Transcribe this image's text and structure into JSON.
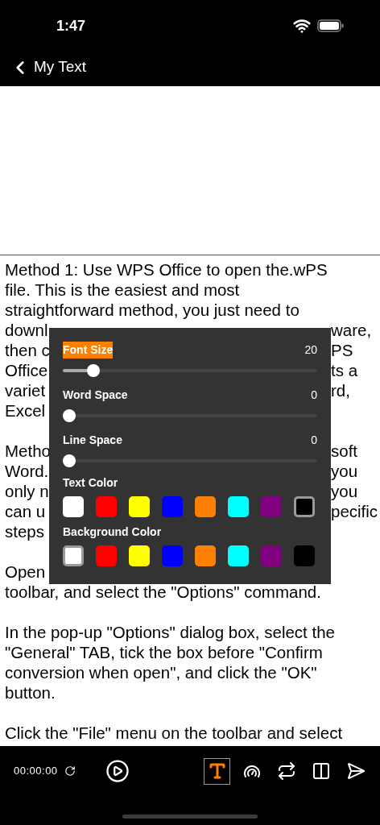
{
  "status_bar": {
    "time": "1:47"
  },
  "nav": {
    "back_label": "My Text"
  },
  "document": {
    "paragraphs": [
      {
        "lines": [
          {
            "left": "Method 1: Use WPS Office to open the.wPS"
          },
          {
            "left": "file. This is the easiest and most"
          },
          {
            "left": "straightforward method, you just need to"
          },
          {
            "left": "downl",
            "right": "ware,"
          },
          {
            "left": "then c",
            "right": "PS"
          },
          {
            "left": "Office",
            "right": "ts a"
          },
          {
            "left": "variet",
            "right": "rd,"
          },
          {
            "left": "Excel"
          }
        ]
      },
      {
        "lines": [
          {
            "left": "Metho",
            "right": "soft"
          },
          {
            "left": "Word.",
            "right": "you"
          },
          {
            "left": "only n",
            "right": "you"
          },
          {
            "left": "can u",
            "right": "pecific"
          },
          {
            "left": "steps"
          }
        ]
      },
      {
        "lines": [
          {
            "left": "Open"
          },
          {
            "left": "toolbar, and select the \"Options\" command."
          }
        ]
      },
      {
        "lines": [
          {
            "left": "In the pop-up \"Options\" dialog box, select the"
          },
          {
            "left": "\"General\" TAB, tick the box before \"Confirm"
          },
          {
            "left": "conversion when open\", and click the \"OK\""
          },
          {
            "left": "button."
          }
        ]
      },
      {
        "lines": [
          {
            "left": "Click the \"File\" menu on the toolbar and select"
          }
        ]
      }
    ]
  },
  "settings_panel": {
    "sliders": [
      {
        "label": "Font Size",
        "value": "20",
        "level": 0.1,
        "highlighted": true
      },
      {
        "label": "Word Space",
        "value": "0",
        "level": 0,
        "highlighted": false
      },
      {
        "label": "Line Space",
        "value": "0",
        "level": 0,
        "highlighted": false
      }
    ],
    "color_groups": [
      {
        "label": "Text Color",
        "swatches": [
          {
            "color": "#ffffff",
            "selected": false
          },
          {
            "color": "#ff0000",
            "selected": false
          },
          {
            "color": "#ffff00",
            "selected": false
          },
          {
            "color": "#0000ff",
            "selected": false
          },
          {
            "color": "#ff8000",
            "selected": false
          },
          {
            "color": "#00ffff",
            "selected": false
          },
          {
            "color": "#800080",
            "selected": false
          },
          {
            "color": "#000000",
            "selected": true
          }
        ]
      },
      {
        "label": "Background Color",
        "swatches": [
          {
            "color": "#ffffff",
            "selected": true
          },
          {
            "color": "#ff0000",
            "selected": false
          },
          {
            "color": "#ffff00",
            "selected": false
          },
          {
            "color": "#0000ff",
            "selected": false
          },
          {
            "color": "#ff8000",
            "selected": false
          },
          {
            "color": "#00ffff",
            "selected": false
          },
          {
            "color": "#800080",
            "selected": false
          },
          {
            "color": "#000000",
            "selected": false
          }
        ]
      }
    ]
  },
  "player": {
    "time": "00:00:00",
    "tools": [
      {
        "kind": "text",
        "selected": true
      },
      {
        "kind": "speed",
        "selected": false
      },
      {
        "kind": "repeat",
        "selected": false
      },
      {
        "kind": "layout",
        "selected": false
      },
      {
        "kind": "send",
        "selected": false
      }
    ]
  }
}
